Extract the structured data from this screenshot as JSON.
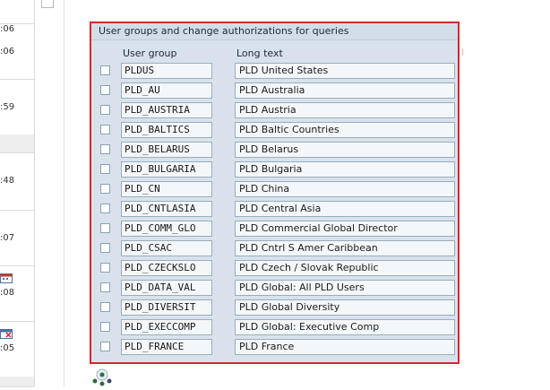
{
  "left_strip": {
    "items": [
      {
        "time": ":06"
      },
      {
        "time": ":59"
      },
      {
        "time": ""
      },
      {
        "time": ":48"
      },
      {
        "time": ":07"
      },
      {
        "time": ":08",
        "icon": "calendar-icon"
      },
      {
        "time": ":05",
        "icon": "calendar-delete-icon"
      }
    ]
  },
  "dialog": {
    "title": "User groups and change authorizations for queries",
    "col_group": "User group",
    "col_text": "Long text",
    "rows": [
      {
        "group": "PLDUS",
        "text": "PLD United States"
      },
      {
        "group": "PLD_AU",
        "text": "PLD Australia"
      },
      {
        "group": "PLD_AUSTRIA",
        "text": "PLD Austria"
      },
      {
        "group": "PLD_BALTICS",
        "text": "PLD Baltic Countries"
      },
      {
        "group": "PLD_BELARUS",
        "text": "PLD Belarus"
      },
      {
        "group": "PLD_BULGARIA",
        "text": "PLD Bulgaria"
      },
      {
        "group": "PLD_CN",
        "text": "PLD China"
      },
      {
        "group": "PLD_CNTLASIA",
        "text": "PLD Central Asia"
      },
      {
        "group": "PLD_COMM_GLO",
        "text": "PLD Commercial Global Director"
      },
      {
        "group": "PLD_CSAC",
        "text": "PLD Cntrl S Amer Caribbean"
      },
      {
        "group": "PLD_CZECKSLO",
        "text": "PLD Czech / Slovak Republic"
      },
      {
        "group": "PLD_DATA_VAL",
        "text": "PLD Global: All PLD Users"
      },
      {
        "group": "PLD_DIVERSIT",
        "text": "PLD Global Diversity"
      },
      {
        "group": "PLD_EXECCOMP",
        "text": "PLD Global: Executive Comp"
      },
      {
        "group": "PLD_FRANCE",
        "text": "PLD France"
      }
    ]
  },
  "bottom_icon": "org-network-icon",
  "colors": {
    "dialog_border": "#d6262c",
    "dialog_bg": "#d9e2ec"
  }
}
